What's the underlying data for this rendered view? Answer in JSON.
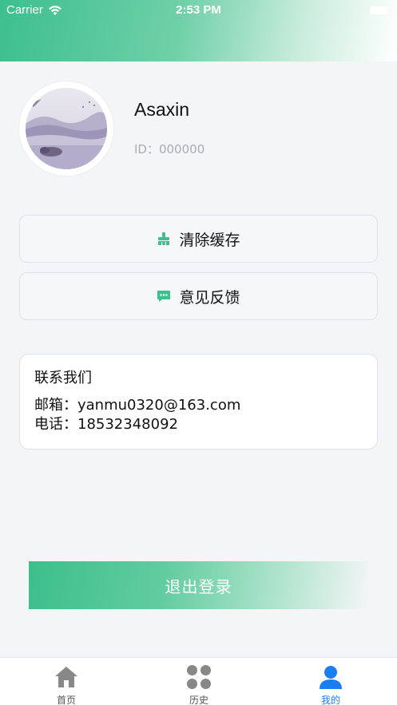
{
  "status_bar": {
    "carrier": "Carrier",
    "time": "2:53 PM"
  },
  "colors": {
    "accent": "#3dbf8e",
    "tab_active": "#1a7ef0",
    "tab_inactive": "#888888"
  },
  "profile": {
    "username": "Asaxin",
    "id_text": "ID：000000"
  },
  "menu": {
    "clear_cache_label": "清除缓存",
    "clear_cache_icon": "broom-icon",
    "feedback_label": "意见反馈",
    "feedback_icon": "message-icon"
  },
  "contact": {
    "title": "联系我们",
    "email_line": "邮箱：yanmu0320@163.com",
    "phone_line": "电话：18532348092"
  },
  "logout_label": "退出登录",
  "tabs": [
    {
      "label": "首页",
      "icon": "home-icon",
      "active": false
    },
    {
      "label": "历史",
      "icon": "grid-icon",
      "active": false
    },
    {
      "label": "我的",
      "icon": "user-icon",
      "active": true
    }
  ]
}
